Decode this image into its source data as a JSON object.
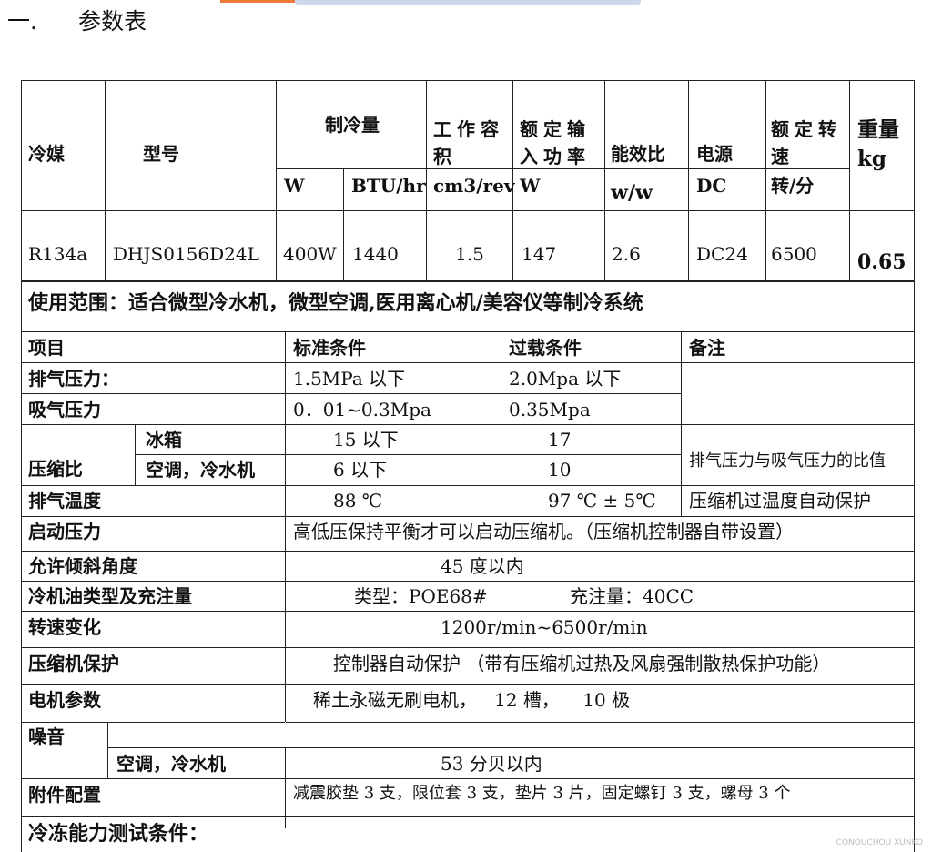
{
  "heading": {
    "number": "一.",
    "title": "参数表"
  },
  "spec_header": {
    "refrigerant": "冷媒",
    "model": "型号",
    "cooling_capacity": "制冷量",
    "displacement": "工作容积",
    "rated_input": "额定输入功率",
    "cop": "能效比",
    "power": "电源",
    "rated_speed": "额定转速",
    "weight": "重量kg",
    "units": {
      "cap_w": "W",
      "cap_btu": "BTU/hr",
      "displacement": "cm3/rev",
      "input": "W",
      "cop": "w/w",
      "power": "DC",
      "speed": "转/分"
    }
  },
  "spec_row": {
    "refrigerant": "R134a",
    "model": "DHJS0156D24L",
    "cap_w": "400W",
    "cap_btu": "1440",
    "displacement": "1.5",
    "input": "147",
    "cop": "2.6",
    "power": "DC24",
    "speed": "6500",
    "weight": "0.65"
  },
  "usage": "使用范围：适合微型冷水机，微型空调,医用离心机/美容仪等制冷系统",
  "cond_header": {
    "item": "项目",
    "standard": "标准条件",
    "overload": "过载条件",
    "note": "备注"
  },
  "discharge_pressure": {
    "label": "排气压力：",
    "standard": "1.5MPa 以下",
    "overload": "2.0Mpa 以下"
  },
  "suction_pressure": {
    "label": "吸气压力",
    "standard": "0．01~0.3Mpa",
    "overload": "0.35Mpa"
  },
  "compression_ratio": {
    "label": "压缩比",
    "fridge": {
      "label": "冰箱",
      "standard": "15 以下",
      "overload": "17"
    },
    "ac": {
      "label": "空调，冷水机",
      "standard": "6 以下",
      "overload": "10"
    },
    "note": "排气压力与吸气压力的比值"
  },
  "discharge_temp": {
    "label": "排气温度",
    "standard": "88 ℃",
    "overload": "97 ℃ ± 5℃",
    "note": "压缩机过温度自动保护"
  },
  "start_pressure": {
    "label": "启动压力",
    "value": "高低压保持平衡才可以启动压缩机。（压缩机控制器自带设置）"
  },
  "tilt": {
    "label": "允许倾斜角度",
    "value": "45 度以内"
  },
  "oil": {
    "label": "冷机油类型及充注量",
    "type": "类型：POE68#",
    "charge": "充注量：40CC"
  },
  "speed_change": {
    "label": "转速变化",
    "value": "1200r/min~6500r/min"
  },
  "protection": {
    "label": "压缩机保护",
    "value": "控制器自动保护 （带有压缩机过热及风扇强制散热保护功能）"
  },
  "motor": {
    "label": "电机参数",
    "value": "稀土永磁无刷电机，   12 槽，    10 极"
  },
  "noise": {
    "label": "噪音",
    "sub_label": "空调，冷水机",
    "value": "53 分贝以内"
  },
  "accessories": {
    "label": "附件配置",
    "value": "减震胶垫 3 支，限位套 3 支，垫片 3 片，固定螺钉 3 支，螺母 3 个"
  },
  "test_conditions": "冷冻能力测试条件：",
  "watermark": "CONOUCHOU XUNKO"
}
